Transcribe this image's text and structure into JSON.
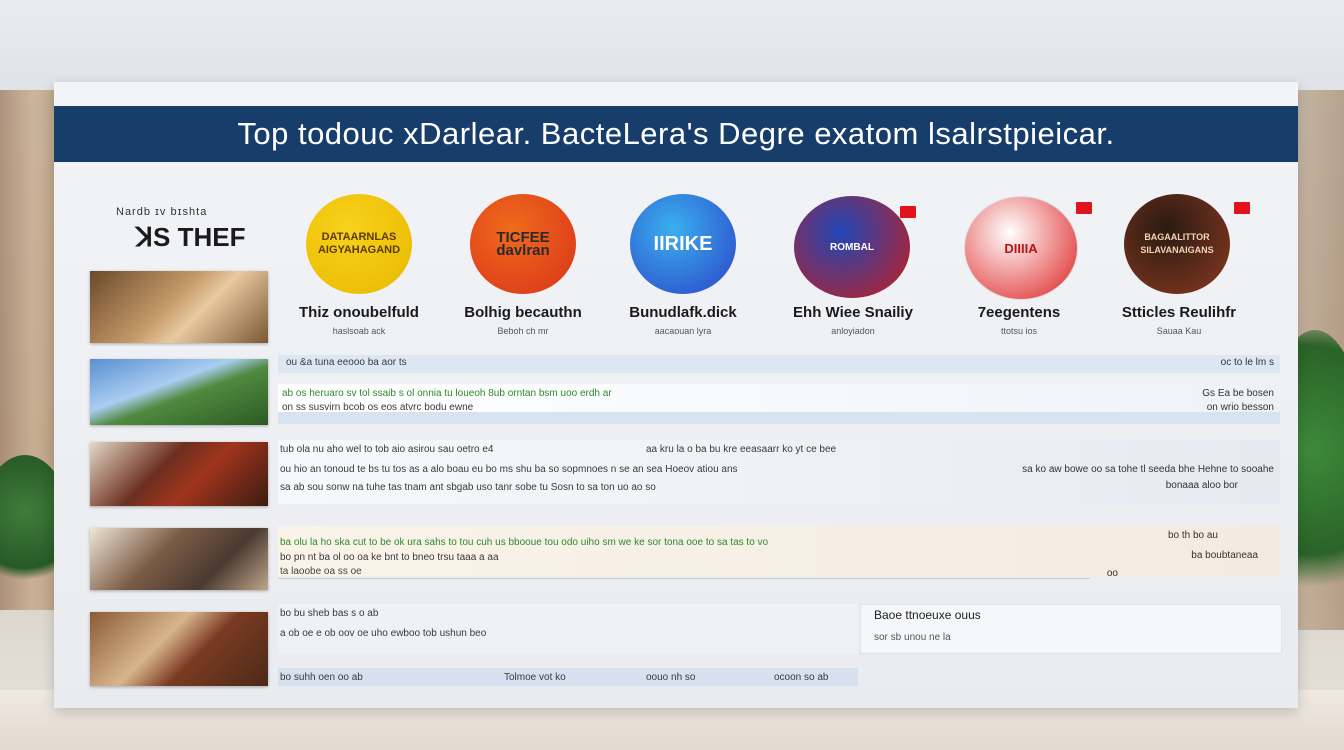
{
  "banner": {
    "title": "Top todouc xDarlear. BacteLera's Degre exatom lsalrstpieicar."
  },
  "category": {
    "label": "Nardb ɪv bɪshta",
    "title": "ꓘS THEF"
  },
  "columns": [
    {
      "name": "Thiz onoubelfuld",
      "sub": "haslsoab ack",
      "badge_text": "DATAARNLAS\nAIGYAHAGAND",
      "colors": [
        "#f7d21b",
        "#e9b800"
      ]
    },
    {
      "name": "Bolhig becauthn",
      "sub": "Beboh ch mr",
      "badge_text": "TICFEE\ndavlran",
      "colors": [
        "#f06a1c",
        "#d9331a"
      ]
    },
    {
      "name": "Bunudlafk.dick",
      "sub": "aacaouan lyra",
      "badge_text": "IIRIKE",
      "colors": [
        "#3ab0ee",
        "#2b43c8"
      ]
    },
    {
      "name": "Ehh Wiee Snailiy",
      "sub": "anloyiadon",
      "badge_text": "ROMBAL",
      "colors": [
        "#1f47b6",
        "#c61d1d"
      ]
    },
    {
      "name": "7eegentens",
      "sub": "ttotsu ios",
      "badge_text": "DIIIIA",
      "colors": [
        "#ffffff",
        "#dd1c1c"
      ]
    },
    {
      "name": "Stticles Reulihfr",
      "sub": "Sauaa Kau",
      "badge_text": "BAGAALITTOR\nSILAVANAIGANS",
      "colors": [
        "#2a1a12",
        "#8a3a20"
      ]
    }
  ],
  "rows": [
    {
      "lines": [
        "ou &a tuna eeooo ba aor ts",
        "ab os heruaro sv tol ssaib s ol onnia tu loueoh 8ub orntan bsm uoo erdh ar",
        "on ss susvirn bcob os eos atvrc bodu ewne"
      ],
      "right": [
        "oc to le lm s",
        "Gs Ea be bosen",
        "on wrio besson"
      ]
    },
    {
      "lines": [
        "tub ola nu aho wel to tob aio asirou sau oetro e4",
        "ou hio an tonoud te bs tu tos as a alo boau eu bo ms shu ba so sopmnoes n se an sea Hoeov atiou ans",
        "sa ab sou sonw na tuhe tas tnam ant sbgab uso tanr sobe tu Sosn to sa ton uo ao so"
      ],
      "middle": "aa kru la o ba bu kre eeasaarr ko yt ce bee",
      "right": [
        "sa ko aw bowe oo sa tohe tl seeda bhe Hehne to sooahe",
        "bonaaa aloo bor"
      ]
    },
    {
      "lines": [
        "ba olu la ho ska cut to be ok ura sahs to tou cuh us bbooue tou odo uiho sm we ke sor tona ooe to sa tas to vo",
        "bo pn nt ba ol oo oa ke bnt to bneo trsu taaa a aa",
        "ta laoobe oa ss oe"
      ],
      "right": [
        "bo th bo au",
        "ba boubtaneaa",
        "oo"
      ]
    },
    {
      "lines": [
        "bo bu sheb bas s o ab",
        "a ob oe e ob oov oe uho ewboo tob ushun beo",
        "bo suhh oen oo ab",
        "sor sb unou ne la"
      ],
      "middle": "Baoe ttnoeuxe ouus",
      "bottom": [
        "Tolmoe vot ko",
        "oouo nh so",
        "ocoon so ab"
      ]
    }
  ]
}
